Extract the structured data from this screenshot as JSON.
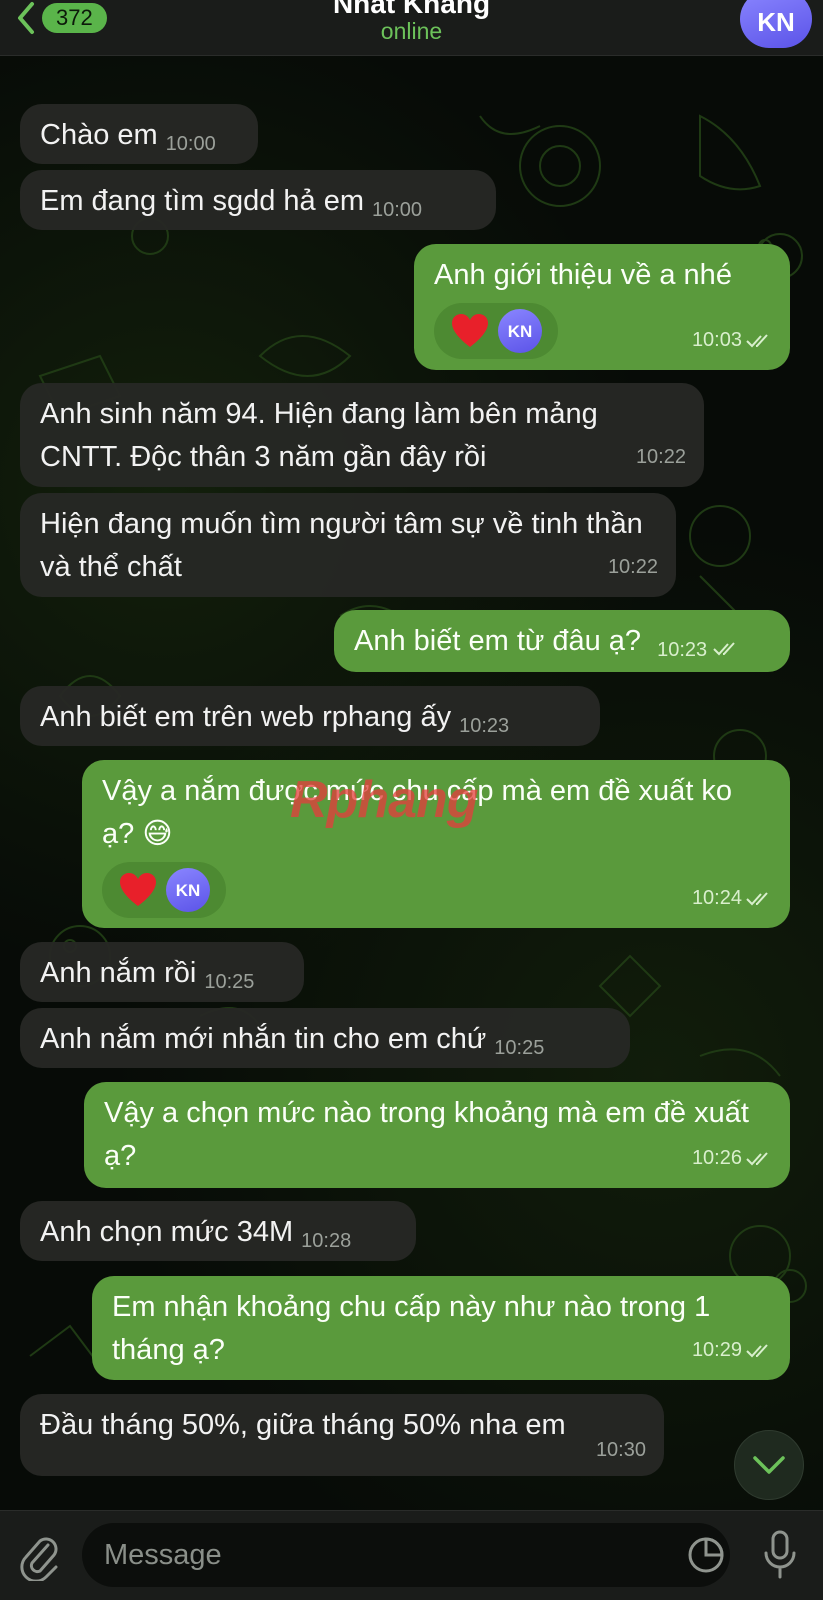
{
  "header": {
    "back_count": "372",
    "contact_name": "Nhat Khang",
    "status": "online",
    "avatar_initials": "KN"
  },
  "messages": [
    {
      "dir": "in",
      "text": "Chào em",
      "time": "10:00"
    },
    {
      "dir": "in",
      "text": "Em đang tìm sgdd hả em",
      "time": "10:00"
    },
    {
      "dir": "out",
      "text": "Anh giới thiệu về a nhé",
      "time": "10:03",
      "reaction": "❤️",
      "reaction_initials": "KN"
    },
    {
      "dir": "in",
      "text": "Anh sinh năm 94. Hiện đang làm bên mảng CNTT. Độc thân 3 năm gần đây rồi",
      "time": "10:22"
    },
    {
      "dir": "in",
      "text": "Hiện đang muốn tìm người tâm sự về tinh thần và thể chất",
      "time": "10:22"
    },
    {
      "dir": "out",
      "text": "Anh biết em từ đâu ạ?",
      "time": "10:23"
    },
    {
      "dir": "in",
      "text": "Anh biết em trên web rphang ấy",
      "time": "10:23"
    },
    {
      "dir": "out",
      "text": "Vậy a nắm được mức chu cấp mà em đề xuất ko ạ? 😅",
      "time": "10:24",
      "reaction": "❤️",
      "reaction_initials": "KN"
    },
    {
      "dir": "in",
      "text": "Anh nắm rồi",
      "time": "10:25"
    },
    {
      "dir": "in",
      "text": "Anh nắm mới nhắn tin cho em chứ",
      "time": "10:25"
    },
    {
      "dir": "out",
      "text": "Vậy a chọn mức nào trong khoảng mà em đề xuất ạ?",
      "time": "10:26"
    },
    {
      "dir": "in",
      "text": "Anh chọn mức 34M",
      "time": "10:28"
    },
    {
      "dir": "out",
      "text": "Em nhận khoảng chu cấp này như nào trong 1 tháng ạ?",
      "time": "10:29"
    },
    {
      "dir": "in",
      "text": "Đầu tháng 50%, giữa tháng 50% nha em",
      "time": "10:30"
    }
  ],
  "watermark": "Rphang",
  "composer": {
    "placeholder": "Message"
  },
  "colors": {
    "outgoing_bubble": "#5a9a3c",
    "incoming_bubble": "#262824",
    "accent_green": "#6cc25a",
    "avatar": "#6b64f0"
  },
  "icons": [
    "chevron-left-icon",
    "heart-icon",
    "double-check-icon",
    "paperclip-icon",
    "sticker-icon",
    "microphone-icon",
    "chevron-down-icon"
  ]
}
